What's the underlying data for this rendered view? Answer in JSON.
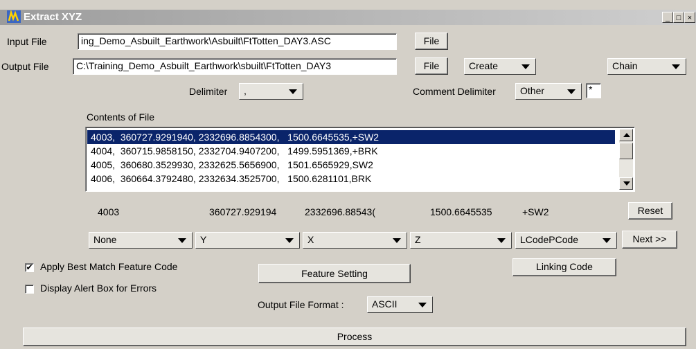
{
  "window": {
    "title": "Extract XYZ",
    "min": "_",
    "max": "□",
    "close": "×"
  },
  "input_file": {
    "label": "Input  File",
    "value": "ing_Demo_Asbuilt_Earthwork\\Asbuilt\\FtTotten_DAY3.ASC",
    "button": "File"
  },
  "output_file": {
    "label": "Output File",
    "value": "C:\\Training_Demo_Asbuilt_Earthwork\\sbuilt\\FtTotten_DAY3",
    "button": "File",
    "create": "Create",
    "chain": "Chain"
  },
  "delimiter": {
    "label": "Delimiter",
    "value": ","
  },
  "comment_delimiter": {
    "label": "Comment Delimiter",
    "value": "Other",
    "char": "*"
  },
  "contents": {
    "label": "Contents of File",
    "rows": [
      "4003,  360727.9291940, 2332696.8854300,   1500.6645535,+SW2",
      "4004,  360715.9858150, 2332704.9407200,   1499.5951369,+BRK",
      "4005,  360680.3529930, 2332625.5656900,   1501.6565929,SW2",
      "4006,  360664.3792480, 2332634.3525700,   1500.6281101,BRK"
    ]
  },
  "parsed": {
    "f1": "4003",
    "f2": "360727.929194",
    "f3": "2332696.88543(",
    "f4": "1500.6645535",
    "f5": "+SW2"
  },
  "mapping": {
    "m1": "None",
    "m2": "Y",
    "m3": "X",
    "m4": "Z",
    "m5": "LCodePCode"
  },
  "buttons": {
    "reset": "Reset",
    "next": "Next >>",
    "feature": "Feature Setting",
    "linking": "Linking Code",
    "process": "Process"
  },
  "options": {
    "best_match": "Apply Best Match Feature Code",
    "best_match_checked": "✔",
    "alert_box": "Display Alert Box for Errors"
  },
  "format": {
    "label": "Output File Format :",
    "value": "ASCII"
  }
}
